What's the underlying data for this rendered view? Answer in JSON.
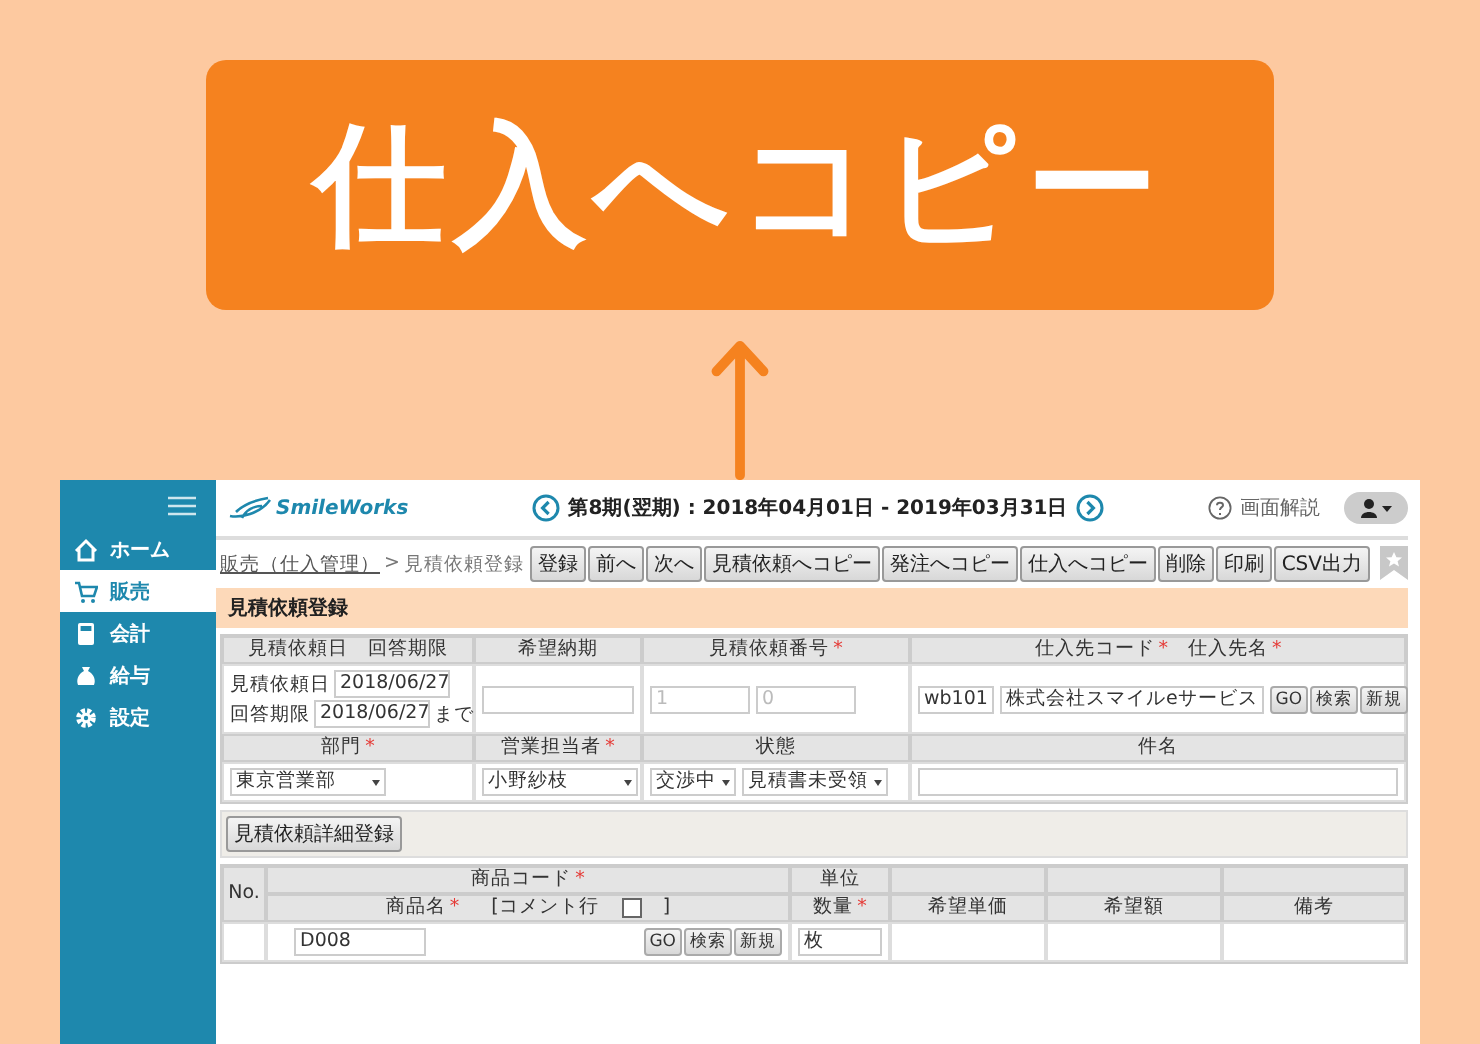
{
  "callout": {
    "label": "仕入へコピー"
  },
  "app": {
    "sidebar": {
      "items": [
        {
          "label": "ホーム",
          "selected": false
        },
        {
          "label": "販売",
          "selected": true
        },
        {
          "label": "会計",
          "selected": false
        },
        {
          "label": "給与",
          "selected": false
        },
        {
          "label": "設定",
          "selected": false
        }
      ]
    },
    "header": {
      "logo": "SmileWorks",
      "period": "第8期(翌期) : 2018年04月01日 - 2019年03月31日",
      "help": "画面解説"
    },
    "breadcrumb": {
      "link": "販売（仕入管理）",
      "separator": ">",
      "current": "見積依頼登録"
    },
    "toolbar": [
      "登録",
      "前へ",
      "次へ",
      "見積依頼へコピー",
      "発注へコピー",
      "仕入へコピー",
      "削除",
      "印刷",
      "CSV出力"
    ],
    "page_title": "見積依頼登録",
    "form": {
      "headings_1": [
        [
          {
            "text": "見積依頼日"
          },
          {
            "text": "回答期限"
          }
        ],
        [
          {
            "text": "希望納期"
          }
        ],
        [
          {
            "text": "見積依頼番号",
            "mark": "*"
          }
        ],
        [
          {
            "text": "仕入先コード",
            "mark": "*"
          },
          {
            "text": "仕入先名",
            "mark": "*"
          }
        ]
      ],
      "dates": [
        {
          "label": "見積依頼日",
          "value": "2018/06/27"
        },
        {
          "label": "回答期限",
          "value": "2018/06/27",
          "suffix": "まで"
        }
      ],
      "quote_number": [
        "1",
        "0"
      ],
      "supplier": {
        "code": "wb101",
        "name": "株式会社スマイルeサービス",
        "buttons": [
          "GO",
          "検索",
          "新規"
        ]
      },
      "headings_2": [
        [
          {
            "text": "部門",
            "mark": "*"
          }
        ],
        [
          {
            "text": "営業担当者",
            "mark": "*"
          }
        ],
        [
          {
            "text": "状態"
          }
        ],
        [
          {
            "text": "件名"
          }
        ]
      ],
      "department": "東京営業部",
      "sales_rep": "小野紗枝",
      "status": [
        "交渉中",
        "見積書未受領"
      ]
    },
    "detail_button": "見積依頼詳細登録",
    "details": {
      "no_heading": "No.",
      "code_heading": {
        "text": "商品コード",
        "mark": "*"
      },
      "unit_heading": "単位",
      "name_heading": {
        "text": "商品名",
        "mark": "*"
      },
      "comment_row": {
        "label": "[コメント行",
        "close": "]",
        "checked": false
      },
      "qty_heading": {
        "text": "数量",
        "mark": "*"
      },
      "other_headings": [
        "希望単価",
        "希望額",
        "備考"
      ],
      "rows": [
        {
          "code": "D008",
          "buttons": [
            "GO",
            "検索",
            "新規"
          ],
          "unit": "枚"
        }
      ]
    }
  }
}
